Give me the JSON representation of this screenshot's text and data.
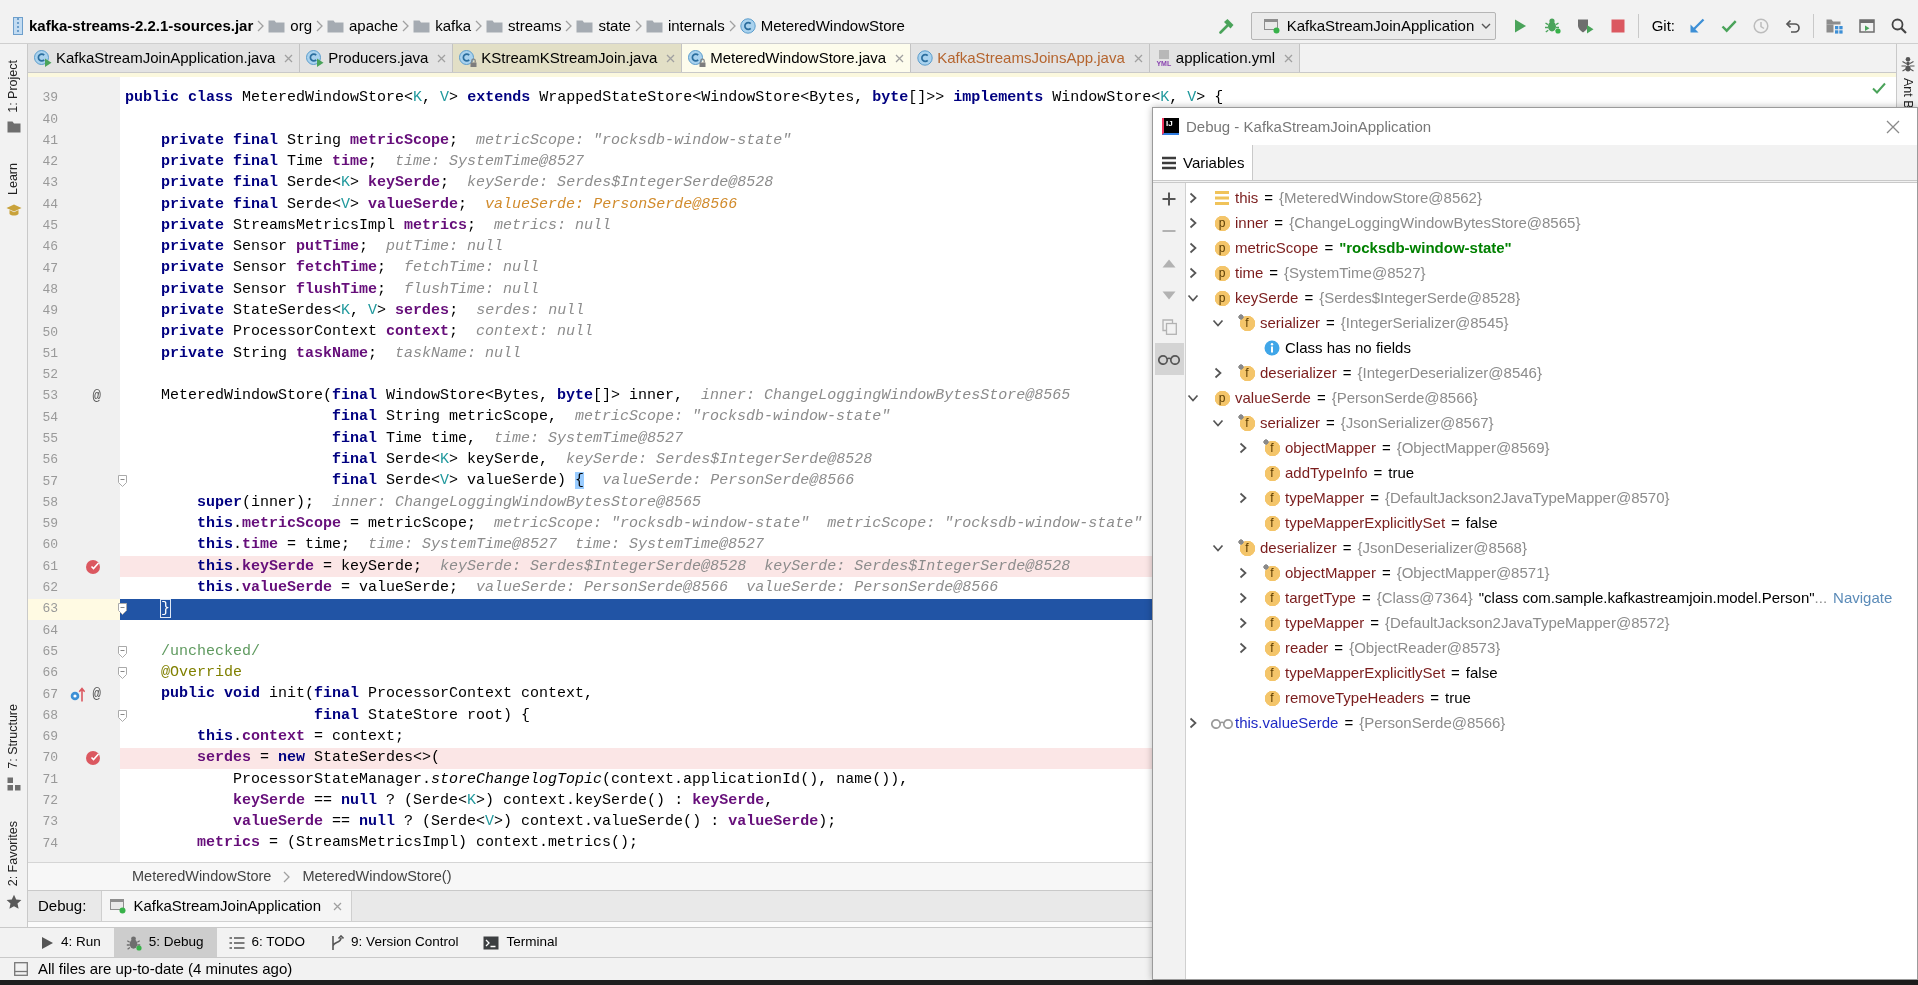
{
  "navigation_bar": {
    "breadcrumbs": [
      {
        "kind": "archive",
        "label": "kafka-streams-2.2.1-sources.jar"
      },
      {
        "kind": "package",
        "label": "org"
      },
      {
        "kind": "package",
        "label": "apache"
      },
      {
        "kind": "package",
        "label": "kafka"
      },
      {
        "kind": "package",
        "label": "streams"
      },
      {
        "kind": "package",
        "label": "state"
      },
      {
        "kind": "package",
        "label": "internals"
      },
      {
        "kind": "class",
        "label": "MeteredWindowStore"
      }
    ],
    "toolbar": [
      {
        "kind": "build"
      }
    ],
    "run_configuration": "KafkaStreamJoinApplication",
    "run_actions": [
      {
        "kind": "run"
      },
      {
        "kind": "debug"
      },
      {
        "kind": "coverage"
      },
      {
        "kind": "stop"
      }
    ],
    "vcs_label": "Git:",
    "vcs_actions": [
      {
        "kind": "update",
        "disabled": false
      },
      {
        "kind": "commit",
        "disabled": false
      },
      {
        "kind": "history",
        "disabled": true
      },
      {
        "kind": "revert",
        "disabled": false
      }
    ],
    "tools": [
      {
        "kind": "project-structure"
      },
      {
        "kind": "run-anything"
      },
      {
        "kind": "search"
      }
    ]
  },
  "editor_tabs": [
    {
      "label": "KafkaStreamJoinApplication.java",
      "kind": "run-class",
      "selected": false,
      "library": false,
      "color": "#000000"
    },
    {
      "label": "Producers.java",
      "kind": "run-class",
      "selected": false,
      "library": false,
      "color": "#000000"
    },
    {
      "label": "KStreamKStreamJoin.java",
      "kind": "locked-class",
      "selected": false,
      "library": true,
      "color": "#000000"
    },
    {
      "label": "MeteredWindowStore.java",
      "kind": "locked-class",
      "selected": true,
      "library": true,
      "color": "#000000"
    },
    {
      "label": "KafkaStreamsJoinsApp.java",
      "kind": "class",
      "selected": false,
      "library": false,
      "color": "#b5652f"
    },
    {
      "label": "application.yml",
      "kind": "yaml",
      "type_label": "YML",
      "selected": false,
      "library": false,
      "color": "#000000"
    }
  ],
  "left_stripe": {
    "top": [
      {
        "label": "1: Project",
        "kind": "folder"
      },
      {
        "label": "Learn",
        "kind": "cap"
      }
    ],
    "bottom": [
      {
        "label": "7: Structure",
        "kind": "structure"
      },
      {
        "label": "2: Favorites",
        "kind": "star"
      }
    ]
  },
  "editor": {
    "lines": [
      {
        "number": "39",
        "kind": "plain",
        "tokens": [
          {
            "kind": "keyword",
            "text": "public class "
          },
          {
            "kind": "plain",
            "text": "MeteredWindowStore<"
          },
          {
            "kind": "type-param",
            "text": "K"
          },
          {
            "kind": "plain",
            "text": ", "
          },
          {
            "kind": "type-param",
            "text": "V"
          },
          {
            "kind": "plain",
            "text": "> "
          },
          {
            "kind": "keyword",
            "text": "extends "
          },
          {
            "kind": "plain",
            "text": "WrappedStateStore<WindowStore<Bytes, "
          },
          {
            "kind": "keyword",
            "text": "byte"
          },
          {
            "kind": "plain",
            "text": "[]>> "
          },
          {
            "kind": "keyword",
            "text": "implements "
          },
          {
            "kind": "plain",
            "text": "WindowStore<"
          },
          {
            "kind": "type-param",
            "text": "K"
          },
          {
            "kind": "plain",
            "text": ", "
          },
          {
            "kind": "type-param",
            "text": "V"
          },
          {
            "kind": "plain",
            "text": "> {"
          }
        ]
      },
      {
        "number": "40",
        "kind": "plain"
      },
      {
        "number": "41",
        "kind": "plain",
        "tokens": [
          {
            "kind": "keyword",
            "text": "    private final "
          },
          {
            "kind": "plain",
            "text": "String "
          },
          {
            "kind": "field",
            "text": "metricScope"
          },
          {
            "kind": "plain",
            "text": ";"
          }
        ],
        "hints": [
          {
            "text": "metricScope: \"rocksdb-window-state\"",
            "changed": false
          }
        ]
      },
      {
        "number": "42",
        "kind": "plain",
        "tokens": [
          {
            "kind": "keyword",
            "text": "    private final "
          },
          {
            "kind": "plain",
            "text": "Time "
          },
          {
            "kind": "field",
            "text": "time"
          },
          {
            "kind": "plain",
            "text": ";"
          }
        ],
        "hints": [
          {
            "text": "time: SystemTime@8527",
            "changed": false
          }
        ]
      },
      {
        "number": "43",
        "kind": "plain",
        "tokens": [
          {
            "kind": "keyword",
            "text": "    private final "
          },
          {
            "kind": "plain",
            "text": "Serde<"
          },
          {
            "kind": "type-param",
            "text": "K"
          },
          {
            "kind": "plain",
            "text": "> "
          },
          {
            "kind": "field",
            "text": "keySerde"
          },
          {
            "kind": "plain",
            "text": ";"
          }
        ],
        "hints": [
          {
            "text": "keySerde: Serdes$IntegerSerde@8528",
            "changed": false
          }
        ]
      },
      {
        "number": "44",
        "kind": "plain",
        "tokens": [
          {
            "kind": "keyword",
            "text": "    private final "
          },
          {
            "kind": "plain",
            "text": "Serde<"
          },
          {
            "kind": "type-param",
            "text": "V"
          },
          {
            "kind": "plain",
            "text": "> "
          },
          {
            "kind": "field",
            "text": "valueSerde"
          },
          {
            "kind": "plain",
            "text": ";"
          }
        ],
        "hints": [
          {
            "text": "valueSerde: PersonSerde@8566",
            "changed": true
          }
        ]
      },
      {
        "number": "45",
        "kind": "plain",
        "tokens": [
          {
            "kind": "keyword",
            "text": "    private "
          },
          {
            "kind": "plain",
            "text": "StreamsMetricsImpl "
          },
          {
            "kind": "field",
            "text": "metrics"
          },
          {
            "kind": "plain",
            "text": ";"
          }
        ],
        "hints": [
          {
            "text": "metrics: null",
            "changed": false
          }
        ]
      },
      {
        "number": "46",
        "kind": "plain",
        "tokens": [
          {
            "kind": "keyword",
            "text": "    private "
          },
          {
            "kind": "plain",
            "text": "Sensor "
          },
          {
            "kind": "field",
            "text": "putTime"
          },
          {
            "kind": "plain",
            "text": ";"
          }
        ],
        "hints": [
          {
            "text": "putTime: null",
            "changed": false
          }
        ]
      },
      {
        "number": "47",
        "kind": "plain",
        "tokens": [
          {
            "kind": "keyword",
            "text": "    private "
          },
          {
            "kind": "plain",
            "text": "Sensor "
          },
          {
            "kind": "field",
            "text": "fetchTime"
          },
          {
            "kind": "plain",
            "text": ";"
          }
        ],
        "hints": [
          {
            "text": "fetchTime: null",
            "changed": false
          }
        ]
      },
      {
        "number": "48",
        "kind": "plain",
        "tokens": [
          {
            "kind": "keyword",
            "text": "    private "
          },
          {
            "kind": "plain",
            "text": "Sensor "
          },
          {
            "kind": "field",
            "text": "flushTime"
          },
          {
            "kind": "plain",
            "text": ";"
          }
        ],
        "hints": [
          {
            "text": "flushTime: null",
            "changed": false
          }
        ]
      },
      {
        "number": "49",
        "kind": "plain",
        "tokens": [
          {
            "kind": "keyword",
            "text": "    private "
          },
          {
            "kind": "plain",
            "text": "StateSerdes<"
          },
          {
            "kind": "type-param",
            "text": "K"
          },
          {
            "kind": "plain",
            "text": ", "
          },
          {
            "kind": "type-param",
            "text": "V"
          },
          {
            "kind": "plain",
            "text": "> "
          },
          {
            "kind": "field",
            "text": "serdes"
          },
          {
            "kind": "plain",
            "text": ";"
          }
        ],
        "hints": [
          {
            "text": "serdes: null",
            "changed": false
          }
        ]
      },
      {
        "number": "50",
        "kind": "plain",
        "tokens": [
          {
            "kind": "keyword",
            "text": "    private "
          },
          {
            "kind": "plain",
            "text": "ProcessorContext "
          },
          {
            "kind": "field",
            "text": "context"
          },
          {
            "kind": "plain",
            "text": ";"
          }
        ],
        "hints": [
          {
            "text": "context: null",
            "changed": false
          }
        ]
      },
      {
        "number": "51",
        "kind": "plain",
        "tokens": [
          {
            "kind": "keyword",
            "text": "    private "
          },
          {
            "kind": "plain",
            "text": "String "
          },
          {
            "kind": "field",
            "text": "taskName"
          },
          {
            "kind": "plain",
            "text": ";"
          }
        ],
        "hints": [
          {
            "text": "taskName: null",
            "changed": false
          }
        ]
      },
      {
        "number": "52",
        "kind": "plain"
      },
      {
        "number": "53",
        "kind": "plain",
        "gutter": [
          {
            "kind": "symbol",
            "text": "@"
          }
        ],
        "tokens": [
          {
            "kind": "plain",
            "text": "    MeteredWindowStore("
          },
          {
            "kind": "keyword",
            "text": "final "
          },
          {
            "kind": "plain",
            "text": "WindowStore<Bytes, "
          },
          {
            "kind": "keyword",
            "text": "byte"
          },
          {
            "kind": "plain",
            "text": "[]> inner,"
          }
        ],
        "hints": [
          {
            "text": "inner: ChangeLoggingWindowBytesStore@8565",
            "changed": false
          }
        ]
      },
      {
        "number": "54",
        "kind": "plain",
        "tokens": [
          {
            "kind": "keyword",
            "text": "                       final "
          },
          {
            "kind": "plain",
            "text": "String metricScope,"
          }
        ],
        "hints": [
          {
            "text": "metricScope: \"rocksdb-window-state\"",
            "changed": false
          }
        ]
      },
      {
        "number": "55",
        "kind": "plain",
        "tokens": [
          {
            "kind": "keyword",
            "text": "                       final "
          },
          {
            "kind": "plain",
            "text": "Time time,"
          }
        ],
        "hints": [
          {
            "text": "time: SystemTime@8527",
            "changed": false
          }
        ]
      },
      {
        "number": "56",
        "kind": "plain",
        "tokens": [
          {
            "kind": "keyword",
            "text": "                       final "
          },
          {
            "kind": "plain",
            "text": "Serde<"
          },
          {
            "kind": "type-param",
            "text": "K"
          },
          {
            "kind": "plain",
            "text": "> keySerde,"
          }
        ],
        "hints": [
          {
            "text": "keySerde: Serdes$IntegerSerde@8528",
            "changed": false
          }
        ]
      },
      {
        "number": "57",
        "kind": "plain",
        "gutter": [
          {
            "kind": "fold"
          }
        ],
        "tokens": [
          {
            "kind": "keyword",
            "text": "                       final "
          },
          {
            "kind": "plain",
            "text": "Serde<"
          },
          {
            "kind": "type-param",
            "text": "V"
          },
          {
            "kind": "plain",
            "text": "> valueSerde) "
          },
          {
            "kind": "brace-match",
            "text": "{"
          }
        ],
        "hints": [
          {
            "text": "valueSerde: PersonSerde@8566",
            "changed": false
          }
        ]
      },
      {
        "number": "58",
        "kind": "plain",
        "tokens": [
          {
            "kind": "keyword",
            "text": "        super"
          },
          {
            "kind": "plain",
            "text": "(inner);"
          }
        ],
        "hints": [
          {
            "text": "inner: ChangeLoggingWindowBytesStore@8565",
            "changed": false
          }
        ]
      },
      {
        "number": "59",
        "kind": "plain",
        "tokens": [
          {
            "kind": "keyword",
            "text": "        this"
          },
          {
            "kind": "plain",
            "text": "."
          },
          {
            "kind": "field",
            "text": "metricScope"
          },
          {
            "kind": "plain",
            "text": " = metricScope;"
          }
        ],
        "hints": [
          {
            "text": "metricScope: \"rocksdb-window-state\"",
            "changed": false
          },
          {
            "text": "metricScope: \"rocksdb-window-state\"",
            "changed": false
          }
        ]
      },
      {
        "number": "60",
        "kind": "plain",
        "tokens": [
          {
            "kind": "keyword",
            "text": "        this"
          },
          {
            "kind": "plain",
            "text": "."
          },
          {
            "kind": "field",
            "text": "time"
          },
          {
            "kind": "plain",
            "text": " = time;"
          }
        ],
        "hints": [
          {
            "text": "time: SystemTime@8527",
            "changed": false
          },
          {
            "text": "time: SystemTime@8527",
            "changed": false
          }
        ]
      },
      {
        "number": "61",
        "kind": "breakpoint",
        "gutter": [
          {
            "kind": "breakpoint"
          }
        ],
        "tokens": [
          {
            "kind": "keyword",
            "text": "        this"
          },
          {
            "kind": "plain",
            "text": "."
          },
          {
            "kind": "field",
            "text": "keySerde"
          },
          {
            "kind": "plain",
            "text": " = keySerde;"
          }
        ],
        "hints": [
          {
            "text": "keySerde: Serdes$IntegerSerde@8528",
            "changed": false
          },
          {
            "text": "keySerde: Serdes$IntegerSerde@8528",
            "changed": false
          }
        ]
      },
      {
        "number": "62",
        "kind": "plain",
        "tokens": [
          {
            "kind": "keyword",
            "text": "        this"
          },
          {
            "kind": "plain",
            "text": "."
          },
          {
            "kind": "field",
            "text": "valueSerde"
          },
          {
            "kind": "plain",
            "text": " = valueSerde;"
          }
        ],
        "hints": [
          {
            "text": "valueSerde: PersonSerde@8566",
            "changed": false
          },
          {
            "text": "valueSerde: PersonSerde@8566",
            "changed": false
          }
        ]
      },
      {
        "number": "63",
        "kind": "execution",
        "caret": true,
        "gutter": [
          {
            "kind": "fold"
          }
        ],
        "tokens": [
          {
            "kind": "brace-match",
            "text": "    }"
          }
        ]
      },
      {
        "number": "64",
        "kind": "plain"
      },
      {
        "number": "65",
        "kind": "plain",
        "gutter": [
          {
            "kind": "fold"
          }
        ],
        "tokens": [
          {
            "kind": "comment",
            "text": "    /unchecked/"
          }
        ]
      },
      {
        "number": "66",
        "kind": "plain",
        "gutter": [
          {
            "kind": "fold"
          }
        ],
        "tokens": [
          {
            "kind": "annotation",
            "text": "    @Override"
          }
        ]
      },
      {
        "number": "67",
        "kind": "plain",
        "gutter": [
          {
            "kind": "implements"
          },
          {
            "kind": "symbol",
            "text": "@"
          }
        ],
        "tokens": [
          {
            "kind": "keyword",
            "text": "    public void "
          },
          {
            "kind": "plain",
            "text": "init("
          },
          {
            "kind": "keyword",
            "text": "final "
          },
          {
            "kind": "plain",
            "text": "ProcessorContext context,"
          }
        ]
      },
      {
        "number": "68",
        "kind": "plain",
        "gutter": [
          {
            "kind": "fold"
          }
        ],
        "tokens": [
          {
            "kind": "keyword",
            "text": "                     final "
          },
          {
            "kind": "plain",
            "text": "StateStore root) {"
          }
        ]
      },
      {
        "number": "69",
        "kind": "plain",
        "tokens": [
          {
            "kind": "keyword",
            "text": "        this"
          },
          {
            "kind": "plain",
            "text": "."
          },
          {
            "kind": "field",
            "text": "context"
          },
          {
            "kind": "plain",
            "text": " = context;"
          }
        ]
      },
      {
        "number": "70",
        "kind": "breakpoint",
        "gutter": [
          {
            "kind": "breakpoint"
          }
        ],
        "tokens": [
          {
            "kind": "field",
            "text": "        serdes"
          },
          {
            "kind": "plain",
            "text": " = "
          },
          {
            "kind": "keyword",
            "text": "new "
          },
          {
            "kind": "plain",
            "text": "StateSerdes<>("
          }
        ]
      },
      {
        "number": "71",
        "kind": "plain",
        "tokens": [
          {
            "kind": "plain",
            "text": "            ProcessorStateManager."
          },
          {
            "kind": "static-call",
            "text": "storeChangelogTopic"
          },
          {
            "kind": "plain",
            "text": "(context.applicationId(), name()),"
          }
        ]
      },
      {
        "number": "72",
        "kind": "plain",
        "tokens": [
          {
            "kind": "field",
            "text": "            keySerde"
          },
          {
            "kind": "plain",
            "text": " == "
          },
          {
            "kind": "keyword",
            "text": "null"
          },
          {
            "kind": "plain",
            "text": " ? (Serde<"
          },
          {
            "kind": "type-param",
            "text": "K"
          },
          {
            "kind": "plain",
            "text": ">) context.keySerde() : "
          },
          {
            "kind": "field",
            "text": "keySerde"
          },
          {
            "kind": "plain",
            "text": ","
          }
        ]
      },
      {
        "number": "73",
        "kind": "plain",
        "tokens": [
          {
            "kind": "field",
            "text": "            valueSerde"
          },
          {
            "kind": "plain",
            "text": " == "
          },
          {
            "kind": "keyword",
            "text": "null"
          },
          {
            "kind": "plain",
            "text": " ? (Serde<"
          },
          {
            "kind": "type-param",
            "text": "V"
          },
          {
            "kind": "plain",
            "text": ">) context.valueSerde() : "
          },
          {
            "kind": "field",
            "text": "valueSerde"
          },
          {
            "kind": "plain",
            "text": ");"
          }
        ]
      },
      {
        "number": "74",
        "kind": "plain",
        "tokens": [
          {
            "kind": "field",
            "text": "        metrics"
          },
          {
            "kind": "plain",
            "text": " = (StreamsMetricsImpl) context.metrics();"
          }
        ]
      }
    ],
    "breadcrumbs": [
      "MeteredWindowStore",
      "MeteredWindowStore()"
    ]
  },
  "debug_window": {
    "logo": "IJ",
    "title": "Debug - KafkaStreamJoinApplication",
    "tabs": [
      {
        "label": "Variables",
        "selected": true
      }
    ],
    "toolbar": [
      {
        "kind": "add",
        "disabled": false,
        "selected": false
      },
      {
        "kind": "remove",
        "disabled": true,
        "selected": false
      },
      {
        "kind": "up",
        "disabled": true,
        "selected": false
      },
      {
        "kind": "down",
        "disabled": true,
        "selected": false
      },
      {
        "kind": "copy",
        "disabled": true,
        "selected": false
      },
      {
        "kind": "watches",
        "disabled": false,
        "selected": true
      }
    ],
    "variables": [
      {
        "kind": "object",
        "name": "this",
        "eq": "=",
        "reference": "{MeteredWindowStore@8562}",
        "expanded": false
      },
      {
        "kind": "property",
        "badge": "p",
        "name": "inner",
        "eq": "=",
        "reference": "{ChangeLoggingWindowBytesStore@8565}",
        "expanded": false
      },
      {
        "kind": "property",
        "badge": "p",
        "name": "metricScope",
        "eq": "=",
        "string": "\"rocksdb-window-state\"",
        "expanded": false
      },
      {
        "kind": "property",
        "badge": "p",
        "name": "time",
        "eq": "=",
        "reference": "{SystemTime@8527}",
        "expanded": false
      },
      {
        "kind": "property",
        "badge": "p",
        "name": "keySerde",
        "eq": "=",
        "reference": "{Serdes$IntegerSerde@8528}",
        "expanded": true,
        "children": [
          {
            "kind": "field",
            "badge": "f",
            "final": true,
            "name": "serializer",
            "eq": "=",
            "reference": "{IntegerSerializer@8545}",
            "expanded": true,
            "children": [
              {
                "kind": "info",
                "text": "Class has no fields"
              }
            ]
          },
          {
            "kind": "field",
            "badge": "f",
            "final": true,
            "name": "deserializer",
            "eq": "=",
            "reference": "{IntegerDeserializer@8546}",
            "expanded": false
          }
        ]
      },
      {
        "kind": "property",
        "badge": "p",
        "name": "valueSerde",
        "eq": "=",
        "reference": "{PersonSerde@8566}",
        "expanded": true,
        "children": [
          {
            "kind": "field",
            "badge": "f",
            "final": true,
            "name": "serializer",
            "eq": "=",
            "reference": "{JsonSerializer@8567}",
            "expanded": true,
            "children": [
              {
                "kind": "field",
                "badge": "f",
                "final": true,
                "name": "objectMapper",
                "eq": "=",
                "reference": "{ObjectMapper@8569}",
                "expanded": false
              },
              {
                "kind": "field",
                "badge": "f",
                "final": false,
                "name": "addTypeInfo",
                "eq": "=",
                "value": "true"
              },
              {
                "kind": "field",
                "badge": "f",
                "final": false,
                "name": "typeMapper",
                "eq": "=",
                "reference": "{DefaultJackson2JavaTypeMapper@8570}",
                "expanded": false
              },
              {
                "kind": "field",
                "badge": "f",
                "final": false,
                "name": "typeMapperExplicitlySet",
                "eq": "=",
                "value": "false"
              }
            ]
          },
          {
            "kind": "field",
            "badge": "f",
            "final": true,
            "name": "deserializer",
            "eq": "=",
            "reference": "{JsonDeserializer@8568}",
            "expanded": true,
            "children": [
              {
                "kind": "field",
                "badge": "f",
                "final": true,
                "name": "objectMapper",
                "eq": "=",
                "reference": "{ObjectMapper@8571}",
                "expanded": false
              },
              {
                "kind": "field",
                "badge": "f",
                "final": false,
                "name": "targetType",
                "eq": "=",
                "reference": "{Class@7364}",
                "detail": "\"class com.sample.kafkastreamjoin.model.Person\"",
                "detail_more": "...",
                "link": "Navigate",
                "expanded": false
              },
              {
                "kind": "field",
                "badge": "f",
                "final": false,
                "name": "typeMapper",
                "eq": "=",
                "reference": "{DefaultJackson2JavaTypeMapper@8572}",
                "expanded": false
              },
              {
                "kind": "field",
                "badge": "f",
                "final": false,
                "name": "reader",
                "eq": "=",
                "reference": "{ObjectReader@8573}",
                "expanded": false
              },
              {
                "kind": "field",
                "badge": "f",
                "final": false,
                "name": "typeMapperExplicitlySet",
                "eq": "=",
                "value": "false"
              },
              {
                "kind": "field",
                "badge": "f",
                "final": false,
                "name": "removeTypeHeaders",
                "eq": "=",
                "value": "true"
              }
            ]
          }
        ]
      },
      {
        "kind": "watch",
        "name": "this.valueSerde",
        "eq": "=",
        "reference": "{PersonSerde@8566}",
        "expanded": false
      }
    ]
  },
  "right_stripe": [
    {
      "label": "Ant B",
      "kind": "ant"
    }
  ],
  "debug_panel": {
    "label": "Debug:",
    "tabs": [
      {
        "label": "KafkaStreamJoinApplication",
        "selected": true
      }
    ]
  },
  "tool_window_buttons": [
    {
      "label": "4: Run",
      "kind": "run",
      "selected": false
    },
    {
      "label": "5: Debug",
      "kind": "debug",
      "selected": true
    },
    {
      "label": "6: TODO",
      "kind": "todo",
      "selected": false
    },
    {
      "label": "9: Version Control",
      "kind": "vcs",
      "selected": false
    },
    {
      "label": "Terminal",
      "kind": "terminal",
      "selected": false
    }
  ],
  "status_bar": {
    "text": "All files are up-to-date (4 minutes ago)"
  }
}
